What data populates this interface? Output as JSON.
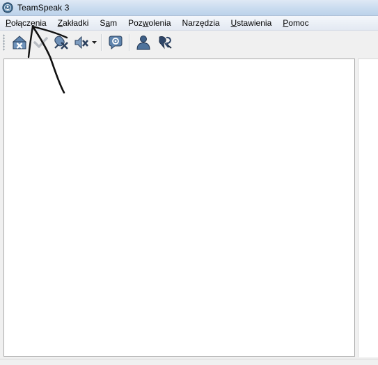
{
  "window": {
    "title": "TeamSpeak 3",
    "icon": "teamspeak-logo-icon"
  },
  "menu": [
    {
      "label": "Połączenia",
      "mnemonic_index": 0
    },
    {
      "label": "Zakładki",
      "mnemonic_index": 0
    },
    {
      "label": "Sam",
      "mnemonic_index": 1
    },
    {
      "label": "Pozwolenia",
      "mnemonic_index": 3
    },
    {
      "label": "Narzędzia",
      "mnemonic_index": -1
    },
    {
      "label": "Ustawienia",
      "mnemonic_index": 0
    },
    {
      "label": "Pomoc",
      "mnemonic_index": 0
    }
  ],
  "toolbar": {
    "buttons": [
      {
        "icon": "disconnect-icon"
      },
      {
        "icon": "away-status-icon"
      },
      {
        "icon": "mute-microphone-icon"
      },
      {
        "icon": "mute-speakers-icon"
      },
      {
        "icon": "subscribe-icon"
      },
      {
        "icon": "contacts-icon"
      },
      {
        "icon": "whisper-icon"
      }
    ]
  },
  "colors": {
    "icon_blue": "#4a6d96",
    "icon_dark": "#2a3f5c",
    "annotation": "#111111"
  }
}
